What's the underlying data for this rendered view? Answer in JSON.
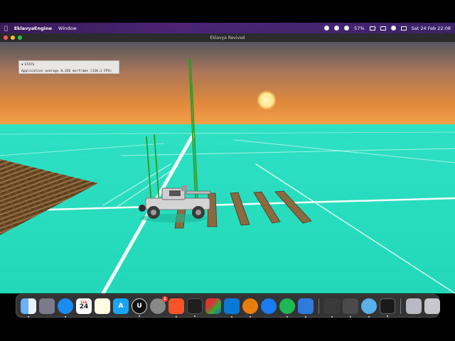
{
  "menubar": {
    "app_name": "EklavyaEngine",
    "menu_window": "Window",
    "battery": "57%",
    "datetime": "Sat 24 Feb  22:08"
  },
  "window": {
    "title": "Eklavya Revived"
  },
  "stats": {
    "header": "STATS",
    "line": "Application average 8.328 ms/frame (120.1 FPS)"
  },
  "dock": {
    "calendar_month": "FEB",
    "calendar_day": "24",
    "notification_badge": "1",
    "apps": [
      "finder-icon",
      "launchpad-icon",
      "safari-icon",
      "calendar-icon",
      "notes-icon",
      "app-store-icon",
      "unreal-engine-icon",
      "system-settings-icon",
      "brave-browser-icon",
      "activity-monitor-icon",
      "affinity-icon",
      "vscode-icon",
      "blender-icon",
      "maps-pin-icon",
      "spotify-icon",
      "xcode-icon",
      "unity-hub-icon",
      "unity-icon",
      "quicktime-icon",
      "terminal-icon",
      "preview-icon",
      "trash-icon"
    ]
  },
  "colors": {
    "ground": "#28dcbe",
    "sky_top": "#5a5a62",
    "sky_horizon": "#e08a3a",
    "plank": "#8a6a40",
    "pole": "#3aa52a"
  }
}
